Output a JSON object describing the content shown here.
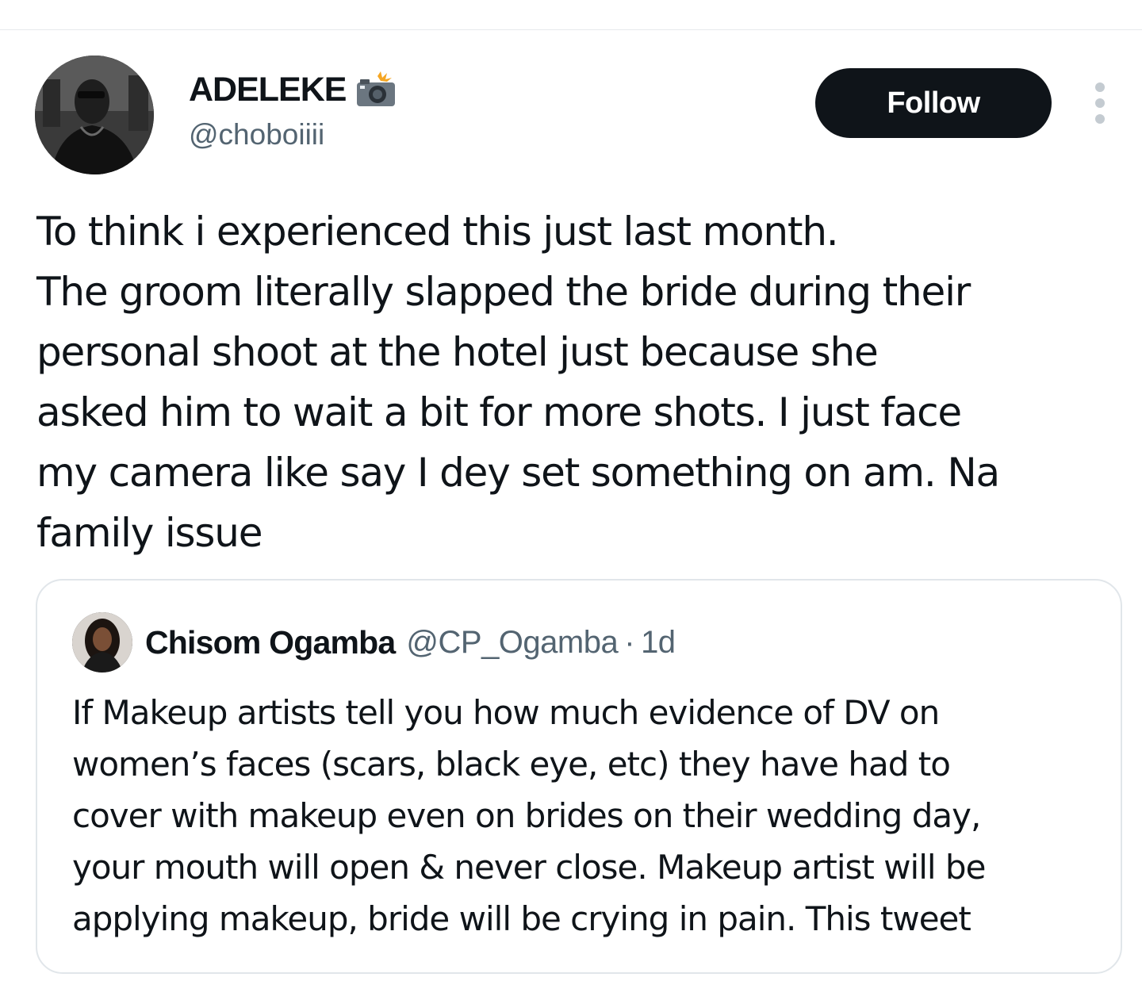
{
  "tweet": {
    "author": {
      "display_name": "ADELEKE",
      "handle": "@choboiiii",
      "name_badge_icon": "camera-with-flash-icon"
    },
    "follow_label": "Follow",
    "text_lines": [
      "To think i experienced this just last month.",
      "The groom literally slapped the bride during their",
      "personal shoot at the hotel just because she",
      "asked him to wait a bit for more shots. I just face",
      "my camera like say I dey set something on am. Na",
      "family issue"
    ]
  },
  "quoted_tweet": {
    "author": {
      "display_name": "Chisom Ogamba",
      "handle": "@CP_Ogamba"
    },
    "separator": "·",
    "time": "1d",
    "text_lines": [
      "If Makeup artists tell you how much evidence of DV on",
      "women’s faces (scars, black eye, etc) they have had to",
      "cover with makeup even on brides on their wedding day,",
      "your mouth will open & never close. Makeup artist will be",
      "applying makeup, bride will be crying in pain. This tweet"
    ]
  },
  "colors": {
    "text_primary": "#0f1419",
    "text_secondary": "#536471",
    "follow_button_bg": "#0f1419",
    "follow_button_text": "#ffffff",
    "card_border": "#e1e6ea",
    "more_dots": "#c4cbd1"
  }
}
